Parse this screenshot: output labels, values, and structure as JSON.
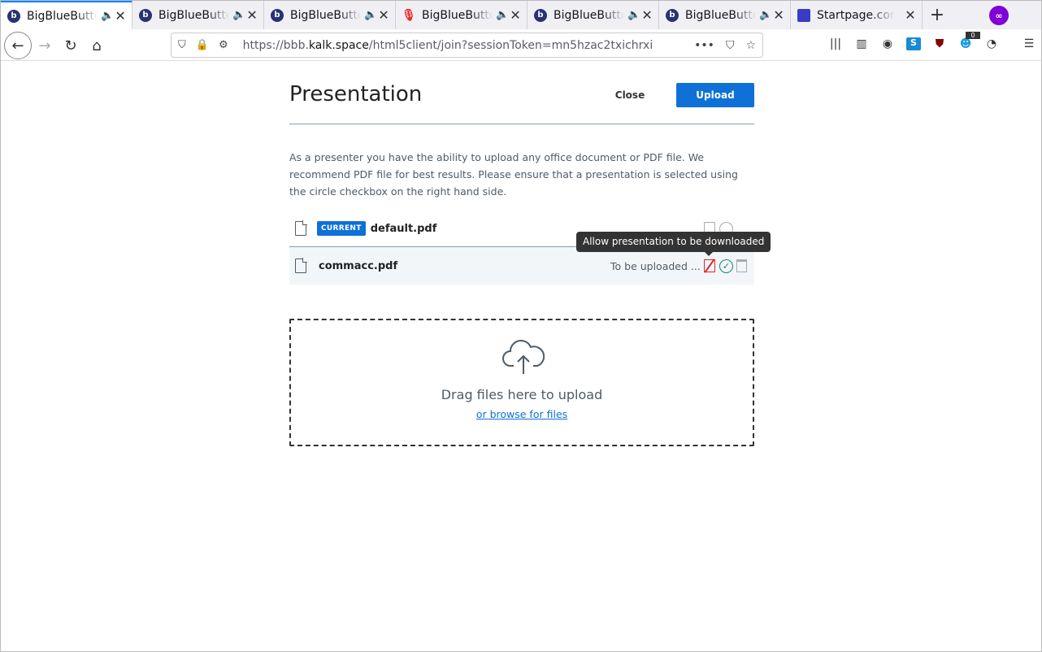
{
  "browser": {
    "tabs": [
      {
        "title": "BigBlueButton",
        "active": true,
        "favicon": "bbb-icon",
        "sound": true
      },
      {
        "title": "BigBlueButton",
        "active": false,
        "favicon": "bbb-icon",
        "sound": true
      },
      {
        "title": "BigBlueButton",
        "active": false,
        "favicon": "bbb-icon",
        "sound": true
      },
      {
        "title": "BigBlueButton",
        "active": false,
        "favicon": "microphone-icon",
        "sound": true
      },
      {
        "title": "BigBlueButton",
        "active": false,
        "favicon": "bbb-icon",
        "sound": true
      },
      {
        "title": "BigBlueButton",
        "active": false,
        "favicon": "bbb-icon",
        "sound": true
      },
      {
        "title": "Startpage.com",
        "active": false,
        "favicon": "startpage-icon",
        "sound": false
      }
    ],
    "url_prefix": "https://bbb.",
    "url_domain": "kalk.space",
    "url_path": "/html5client/join?sessionToken=mn5hzac2txichrxi",
    "ghostery_count": "0"
  },
  "modal": {
    "title": "Presentation",
    "close_label": "Close",
    "upload_label": "Upload",
    "intro": "As a presenter you have the ability to upload any office document or PDF file. We recommend PDF file for best results. Please ensure that a presentation is selected using the circle checkbox on the right hand side.",
    "files": [
      {
        "name": "default.pdf",
        "badge": "CURRENT",
        "status": ""
      },
      {
        "name": "commacc.pdf",
        "badge": "",
        "status": "To be uploaded ..."
      }
    ],
    "tooltip": "Allow presentation to be downloaded",
    "dropzone": {
      "text": "Drag files here to upload",
      "browse": "or browse for files"
    }
  }
}
